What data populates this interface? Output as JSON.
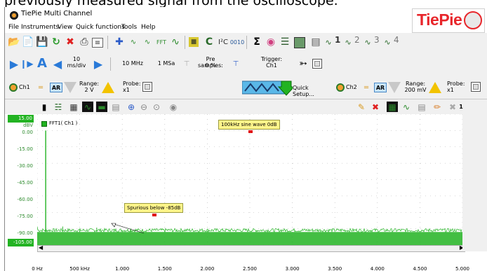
{
  "caption": {
    "text": "previously measured signal from the oscilloscope."
  },
  "window": {
    "title": "TiePie Multi Channel",
    "minimize": "−",
    "maximize": "☐",
    "close": "✕"
  },
  "menu": {
    "items": [
      "File",
      "Instruments",
      "View",
      "Quick functions",
      "Tools",
      "Help"
    ]
  },
  "logo": {
    "text": "TiePie"
  },
  "toolbar1": {
    "icons": [
      "open-folder-icon",
      "open-file-icon",
      "save-icon",
      "refresh-icon",
      "delete-icon",
      "print-icon",
      "properties-icon",
      "add-channel-icon",
      "y-t-icon",
      "xy-icon",
      "fft-icon",
      "meter-icon",
      "calc-icon",
      "c-icon",
      "i2c-icon",
      "serial-icon",
      "sigma-icon",
      "colors-icon",
      "list-icon",
      "grid-icon",
      "display1-icon",
      "display2-icon",
      "display3-icon",
      "display4-icon"
    ],
    "display_numbers": [
      "1",
      "2",
      "3",
      "4"
    ]
  },
  "toolbar2": {
    "timebase_value": "10",
    "timebase_unit": "ms/div",
    "sample_freq": "10 MHz",
    "record_length": "1 MSa",
    "pre_samples_label": "Pre samples:",
    "pre_samples_value": "0 %",
    "trigger_label": "Trigger:",
    "trigger_value": "Ch1"
  },
  "toolbar3": {
    "ch1_label": "Ch1",
    "ch1_ar": "AR",
    "ch1_range_label": "Range:",
    "ch1_range_value": "2 V",
    "ch1_probe_label": "Probe:",
    "ch1_probe_value": "x1",
    "quick_setup": "Quick Setup...",
    "ch2_label": "Ch2",
    "ch2_ar": "AR",
    "ch2_range_label": "Range:",
    "ch2_range_value": "200 mV",
    "ch2_probe_label": "Probe:",
    "ch2_probe_value": "x1"
  },
  "graph": {
    "y_top_value": "15.00",
    "y_unit": "dBV",
    "y_bottom_value": "-105.00",
    "y_labels": [
      "0.00",
      "-15.00",
      "-30.00",
      "-45.00",
      "-60.00",
      "-75.00",
      "-90.00"
    ],
    "x_labels": [
      "0 Hz",
      "500 kHz",
      "1.000 MHz",
      "1.500 MHz",
      "2.000 MHz",
      "2.500 MHz",
      "3.000 MHz",
      "3.500 MHz",
      "4.000 MHz",
      "4.500 MHz",
      "5.000 MHz"
    ],
    "legend": "FFT1( Ch1 )",
    "annotation_main": "100kHz sine wave 0dB",
    "annotation_spur": "Spurious below -85dB",
    "close_count": "1",
    "accent_color": "#22b322"
  },
  "chart_data": {
    "type": "line",
    "xlabel": "",
    "ylabel": "dBV",
    "xlim": [
      0,
      5000000
    ],
    "ylim": [
      -105,
      15
    ],
    "series": [
      {
        "name": "FFT1( Ch1 )",
        "points": [
          [
            100000,
            0
          ],
          [
            300000,
            -88
          ],
          [
            500000,
            -91
          ],
          [
            700000,
            -89
          ],
          [
            900000,
            -91
          ],
          [
            1100000,
            -90
          ],
          [
            1500000,
            -92
          ],
          [
            2000000,
            -92
          ],
          [
            3000000,
            -93
          ],
          [
            4000000,
            -93
          ],
          [
            5000000,
            -93
          ]
        ]
      }
    ]
  }
}
